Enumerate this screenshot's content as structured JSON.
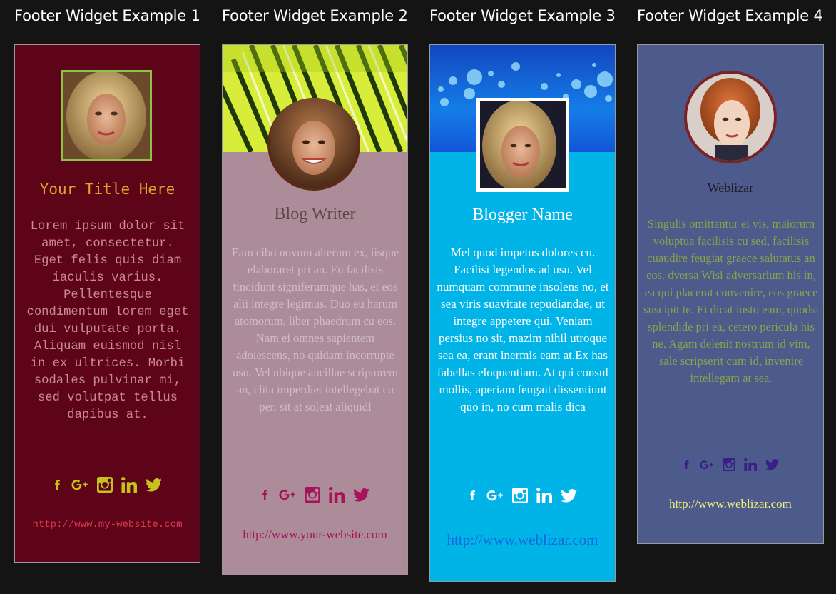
{
  "widgets": [
    {
      "heading": "Footer Widget Example 1",
      "name": "Your Title Here",
      "bio": "Lorem ipsum dolor sit amet, consectetur. Eget felis quis diam iaculis varius. Pellentesque condimentum lorem eget dui vulputate porta. Aliquam euismod nisl in ex ultrices. Morbi sodales pulvinar mi, sed volutpat tellus dapibus at.",
      "link": "http://www.my-website.com",
      "social_icons": [
        "facebook-icon",
        "google-plus-icon",
        "instagram-icon",
        "linkedin-icon",
        "twitter-icon"
      ],
      "colors": {
        "background": "#5e0418",
        "accent": "#c6c21b",
        "link": "#d93a52",
        "avatar_border": "#8bc34a"
      }
    },
    {
      "heading": "Footer Widget Example 2",
      "name": "Blog Writer",
      "bio": "Eam cibo novum alterum ex, iisque elaboraret pri an. Eu facilisis tincidunt signiferumque has, ei eos alii integre legimus. Duo eu harum atomorum, liber phaedrum cu eos. Nam ei omnes sapientem adolescens, no quidam incorrupte usu. Vel ubique ancillae scriptorem an, clita imperdiet intellegebat cu per, sit at soleat aliquidl",
      "link": "http://www.your-website.com",
      "social_icons": [
        "facebook-icon",
        "google-plus-icon",
        "instagram-icon",
        "linkedin-icon",
        "twitter-icon"
      ],
      "colors": {
        "background": "#ad8c99",
        "accent": "#a8125a",
        "link": "#a8125a"
      }
    },
    {
      "heading": "Footer Widget Example 3",
      "name": "Blogger Name",
      "bio": "Mel quod impetus dolores cu. Facilisi legendos ad usu. Vel numquam commune insolens no, et sea viris suavitate repudiandae, ut integre appetere qui. Veniam persius no sit, mazim nihil utroque sea ea, erant inermis eam at.Ex has fabellas eloquentiam. At qui consul mollis, aperiam feugait dissentiunt quo in, no cum malis dica",
      "link": "http://www.weblizar.com",
      "social_icons": [
        "facebook-icon",
        "google-plus-icon",
        "instagram-icon",
        "linkedin-icon",
        "twitter-icon"
      ],
      "colors": {
        "background": "#00b4e8",
        "accent": "#ffffff",
        "link": "#1564e0"
      }
    },
    {
      "heading": "Footer Widget Example 4",
      "name": "Weblizar",
      "bio": "Singulis omittantur ei vis, maiorum voluptua facilisis cu sed, facilisis cuaudire feugiat graece salutatus an eos. dversa Wisi adversarium his in, ea qui placerat convenire, eos graece suscipit te. Ei dicat iusto eam, quodsi splendide pri ea, cetero pericula his ne. Agam delenit nostrum id vim, sale scripserit cum id, invenire intellegam at sea.",
      "link": "http://www.weblizar.com",
      "social_icons": [
        "facebook-icon",
        "google-plus-icon",
        "instagram-icon",
        "linkedin-icon",
        "twitter-icon"
      ],
      "colors": {
        "background": "#4d5a8c",
        "accent": "#3a1e86",
        "link": "#f0ee7a",
        "avatar_border": "#7d2222"
      }
    }
  ]
}
